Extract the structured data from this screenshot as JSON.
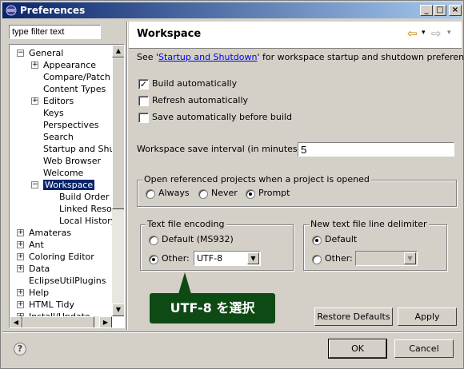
{
  "window": {
    "title": "Preferences",
    "minimize": "_",
    "maximize": "□",
    "close": "×"
  },
  "filter": {
    "value": "type filter text"
  },
  "tree": {
    "items": [
      {
        "label": "General",
        "exp": "−"
      },
      {
        "label": "Appearance",
        "exp": "+"
      },
      {
        "label": "Compare/Patch"
      },
      {
        "label": "Content Types"
      },
      {
        "label": "Editors",
        "exp": "+"
      },
      {
        "label": "Keys"
      },
      {
        "label": "Perspectives"
      },
      {
        "label": "Search"
      },
      {
        "label": "Startup and Shut"
      },
      {
        "label": "Web Browser"
      },
      {
        "label": "Welcome"
      },
      {
        "label": "Workspace",
        "exp": "−",
        "selected": true
      },
      {
        "label": "Build Order"
      },
      {
        "label": "Linked Resou"
      },
      {
        "label": "Local History"
      },
      {
        "label": "Amateras",
        "exp": "+"
      },
      {
        "label": "Ant",
        "exp": "+"
      },
      {
        "label": "Coloring Editor",
        "exp": "+"
      },
      {
        "label": "Data",
        "exp": "+"
      },
      {
        "label": "EclipseUtilPlugins"
      },
      {
        "label": "Help",
        "exp": "+"
      },
      {
        "label": "HTML Tidy",
        "exp": "+"
      },
      {
        "label": "Install/Update",
        "exp": "+"
      }
    ]
  },
  "page": {
    "title": "Workspace",
    "nav_back": "⇦",
    "nav_forward": "⇨",
    "nav_menu": "▾",
    "intro_prefix": "See '",
    "intro_link": "Startup and Shutdown",
    "intro_suffix": "' for workspace startup and shutdown preferences.",
    "checks": [
      {
        "label": "Build automatically",
        "checked": true
      },
      {
        "label": "Refresh automatically",
        "checked": false
      },
      {
        "label": "Save automatically before build",
        "checked": false
      }
    ],
    "check_mark": "✓",
    "save_interval_label": "Workspace save interval (in minutes):",
    "save_interval_value": "5",
    "open_projects": {
      "label": "Open referenced projects when a project is opened",
      "options": [
        "Always",
        "Never",
        "Prompt"
      ],
      "selected": "Prompt"
    },
    "encoding": {
      "label": "Text file encoding",
      "default_label": "Default (MS932)",
      "other_label": "Other:",
      "other_value": "UTF-8",
      "selected": "Other"
    },
    "delimiter": {
      "label": "New text file line delimiter",
      "default_label": "Default",
      "other_label": "Other:",
      "other_value": "",
      "selected": "Default"
    },
    "restore_defaults": "Restore Defaults",
    "apply": "Apply"
  },
  "callout": {
    "text": "UTF-8 を選択"
  },
  "footer": {
    "help": "?",
    "ok": "OK",
    "cancel": "Cancel"
  },
  "colors": {
    "title_start": "#0a246a",
    "title_end": "#a6caf0",
    "callout_bg": "#0e4a14",
    "selection": "#0a246a"
  }
}
